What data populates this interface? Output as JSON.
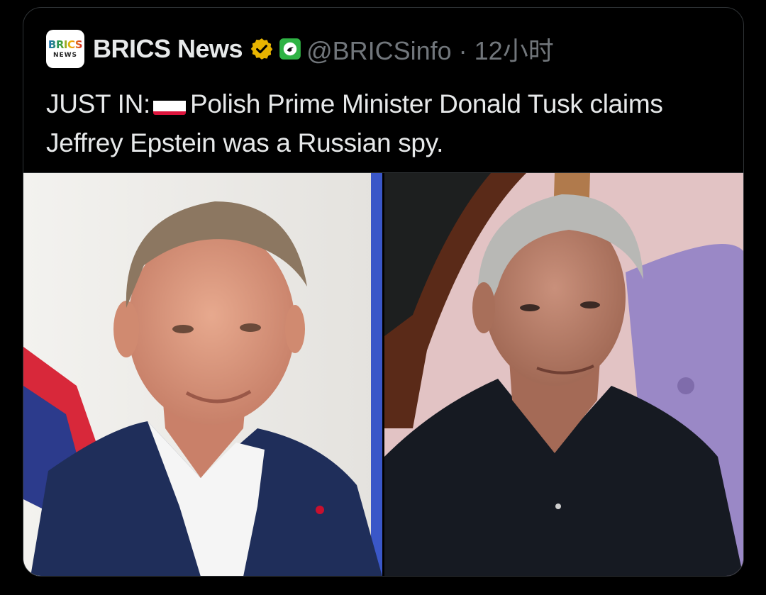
{
  "tweet": {
    "avatar_line1": "BRICS",
    "avatar_line2": "NEWS",
    "display_name": "BRICS News",
    "handle_and_time": "@BRICSinfo · 12小时",
    "text_before_flag": "JUST IN:",
    "text_after_flag": "Polish Prime Minister Donald Tusk claims Jeffrey Epstein was a Russian spy."
  },
  "icons": {
    "verified": "verified-badge-icon",
    "affiliate": "affiliate-badge-icon",
    "flag": "poland-flag-icon"
  },
  "colors": {
    "background": "#000000",
    "text_primary": "#e7e9ea",
    "text_secondary": "#71767b",
    "verified_gold": "#e8b400",
    "affiliate_green": "#2fb344",
    "border": "#2f3336"
  },
  "media": {
    "left_photo": "man-in-navy-suit-portrait",
    "right_photo": "man-in-black-polo-portrait"
  }
}
